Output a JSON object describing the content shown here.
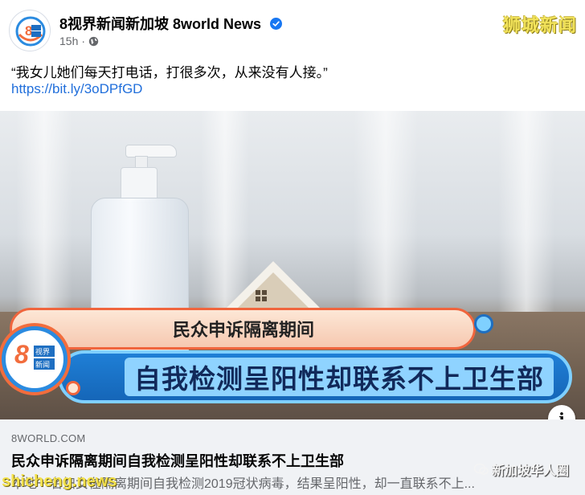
{
  "header": {
    "page_name": "8视界新闻新加坡 8world News",
    "time": "15h",
    "watermark": "狮城新闻",
    "avatar_text_top": "8",
    "avatar_text_bottom": "视界\n新闻网"
  },
  "post": {
    "text": "“我女儿她们每天打电话，打很多次，从来没有人接。”",
    "link": "https://bit.ly/3oDPfGD"
  },
  "image": {
    "banner_top": "民众申诉隔离期间",
    "banner_main": "自我检测呈阳性却联系不上卫生部",
    "logo_num": "8",
    "logo_text": "视界新闻",
    "info_label": "i"
  },
  "preview": {
    "domain": "8WORLD.COM",
    "title": "民众申诉隔离期间自我检测呈阳性却联系不上卫生部",
    "description": "本地一名妇女在隔离期间自我检测2019冠状病毒，结果呈阳性，却一直联系不上..."
  },
  "watermarks": {
    "bottom_left": "shicheng.news",
    "bottom_right": "新加坡华人圈"
  },
  "colors": {
    "link": "#216fdb",
    "verified": "#1877f2",
    "banner_blue": "#1566b8",
    "banner_orange": "#f0653d"
  }
}
